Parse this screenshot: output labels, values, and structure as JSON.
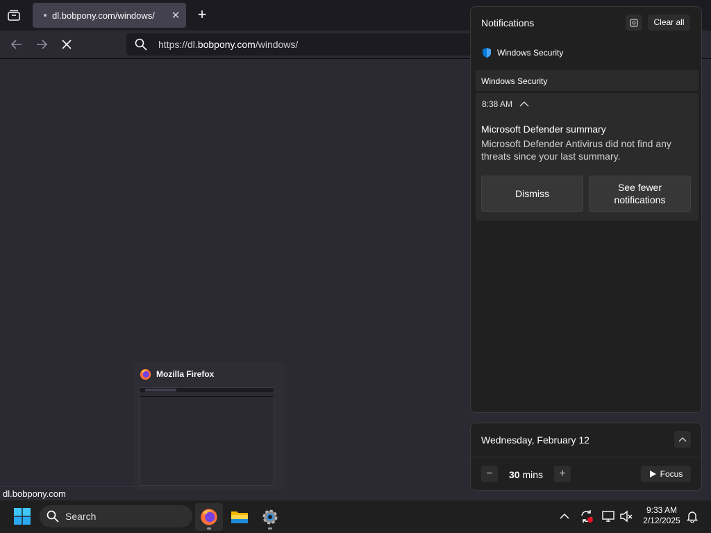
{
  "browser": {
    "tab": {
      "title": "dl.bobpony.com/windows/",
      "close": "✕"
    },
    "new_tab": "+",
    "url": {
      "prefix": "https://dl.",
      "domain": "bobpony.com",
      "suffix": "/windows/"
    },
    "status_text": "dl.bobpony.com"
  },
  "preview": {
    "title": "Mozilla Firefox"
  },
  "notifications": {
    "title": "Notifications",
    "clear_all": "Clear all",
    "app_name": "Windows Security",
    "group_header": "Windows Security",
    "time": "8:38 AM",
    "card_title": "Microsoft Defender summary",
    "card_body": "Microsoft Defender Antivirus did not find any threats since your last summary.",
    "dismiss": "Dismiss",
    "see_fewer": "See fewer notifications"
  },
  "calendar": {
    "date": "Wednesday, February 12",
    "focus_minus": "−",
    "focus_value": "30",
    "focus_unit": "mins",
    "focus_plus": "+",
    "focus_label": "Focus"
  },
  "taskbar": {
    "search_placeholder": "Search",
    "time": "9:33 AM",
    "date": "2/12/2025"
  },
  "colors": {
    "accent_blue": "#0078d4",
    "firefox_orange": "#ff7139",
    "panel_bg": "#202020"
  }
}
